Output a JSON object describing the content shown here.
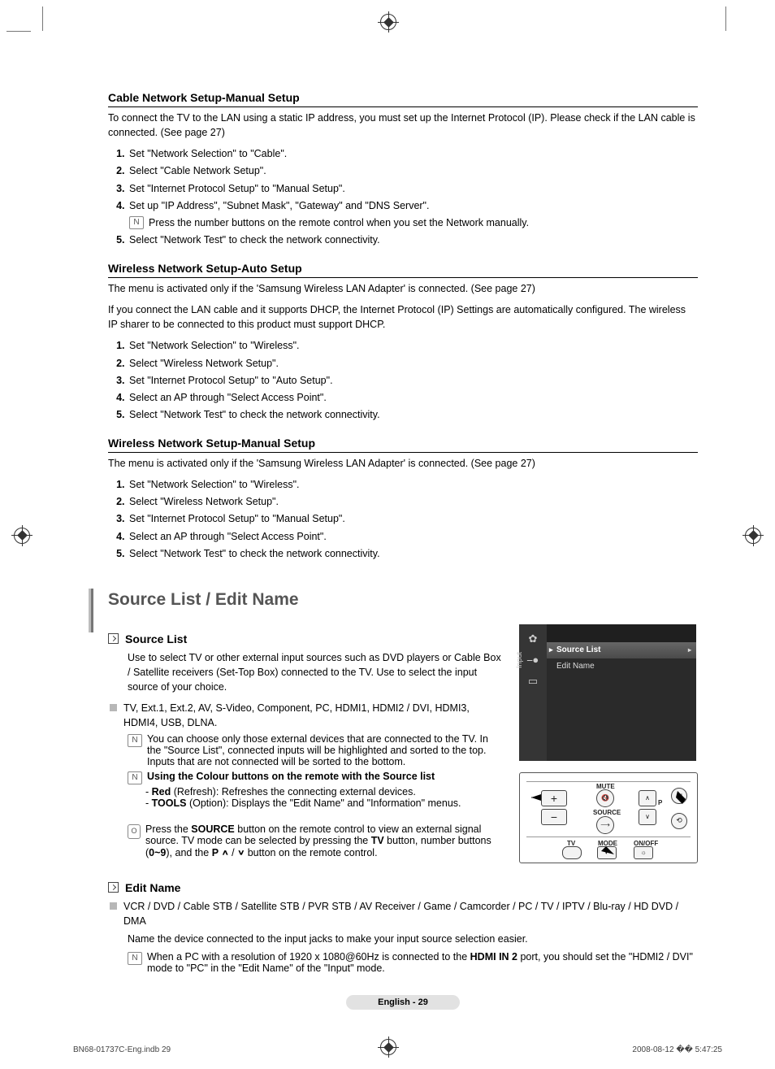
{
  "sections": {
    "cable_manual": {
      "title": "Cable Network Setup-Manual Setup",
      "intro": "To connect the TV to the LAN using a static IP address, you must set up the Internet Protocol (IP). Please check if the LAN cable is connected. (See page 27)",
      "steps": [
        "Set \"Network Selection\" to \"Cable\".",
        "Select \"Cable Network Setup\".",
        "Set \"Internet Protocol Setup\" to \"Manual Setup\".",
        "Set up \"IP Address\", \"Subnet Mask\", \"Gateway\" and \"DNS Server\".",
        "Select \"Network Test\" to check the network connectivity."
      ],
      "step4_note": "Press the number buttons on the remote control when you set the Network manually."
    },
    "wireless_auto": {
      "title": "Wireless Network Setup-Auto Setup",
      "intro1": "The menu is activated only if the 'Samsung Wireless LAN Adapter' is connected. (See page 27)",
      "intro2": "If you connect the LAN cable and it supports DHCP, the Internet Protocol (IP) Settings are automatically configured. The wireless IP sharer to be connected to this product must support DHCP.",
      "steps": [
        "Set \"Network Selection\" to \"Wireless\".",
        "Select \"Wireless Network Setup\".",
        "Set \"Internet Protocol Setup\" to \"Auto Setup\".",
        "Select an AP through \"Select Access Point\".",
        "Select \"Network Test\" to check the network connectivity."
      ]
    },
    "wireless_manual": {
      "title": "Wireless Network Setup-Manual Setup",
      "intro": "The menu is activated only if the 'Samsung Wireless LAN Adapter' is connected. (See page 27)",
      "steps": [
        "Set \"Network Selection\" to \"Wireless\".",
        "Select \"Wireless Network Setup\".",
        "Set \"Internet Protocol Setup\" to \"Manual Setup\".",
        "Select an AP through \"Select Access Point\".",
        "Select \"Network Test\" to check the network connectivity."
      ]
    }
  },
  "source_section": {
    "title": "Source List / Edit Name",
    "source_list": {
      "heading": "Source List",
      "para": "Use to select TV or other external input sources such as DVD players or Cable Box / Satellite receivers (Set-Top Box) connected to the TV. Use to select the input source of your choice.",
      "inputs": "TV, Ext.1, Ext.2, AV, S-Video, Component, PC, HDMI1, HDMI2 / DVI, HDMI3, HDMI4, USB, DLNA.",
      "note1": "You can choose only those external devices that are connected to the TV. In the \"Source List\", connected inputs will be highlighted and sorted to the top. Inputs that are not connected will be sorted to the bottom.",
      "note2_title": "Using the Colour buttons on the remote with the Source list",
      "note2_red_label": "Red",
      "note2_red": " (Refresh): Refreshes the connecting external devices.",
      "note2_tools_label": "TOOLS",
      "note2_tools": " (Option): Displays the \"Edit Name\" and \"Information\" menus.",
      "remote_note_pre": "Press the ",
      "remote_note_source": "SOURCE",
      "remote_note_mid": " button on the remote control to view an external signal source. TV mode can be selected by pressing the ",
      "remote_note_tv": "TV",
      "remote_note_mid2": " button, number buttons (",
      "remote_note_range": "0~9",
      "remote_note_mid3": "), and the ",
      "remote_note_p": "P",
      "remote_note_end": " button on the remote control.",
      "chev_up": "∧",
      "chev_down": "∨",
      "slash": " / "
    },
    "edit_name": {
      "heading": "Edit Name",
      "line1": "VCR / DVD / Cable STB / Satellite STB / PVR STB / AV Receiver / Game / Camcorder / PC / TV / IPTV / Blu-ray / HD DVD / DMA",
      "line2": "Name the device connected to the input jacks to make your input source selection easier.",
      "note_pre": "When a PC with a resolution of 1920 x 1080@60Hz is connected to the ",
      "note_bold": "HDMI IN 2",
      "note_post": " port, you should set the \"HDMI2 / DVI\" mode to \"PC\" in the \"Edit Name\" of the \"Input\" mode."
    }
  },
  "osd": {
    "side_label": "Input",
    "row_selected": "Source List",
    "row2": "Edit Name"
  },
  "remote": {
    "mute": "MUTE",
    "source": "SOURCE",
    "p": "P",
    "tv": "TV",
    "mode": "MODE",
    "onoff": "ON/OFF"
  },
  "footer": {
    "pill": "English - 29",
    "left": "BN68-01737C-Eng.indb   29",
    "right": "2008-08-12   �� 5:47:25"
  },
  "icons": {
    "note": "N",
    "remote": "O"
  }
}
